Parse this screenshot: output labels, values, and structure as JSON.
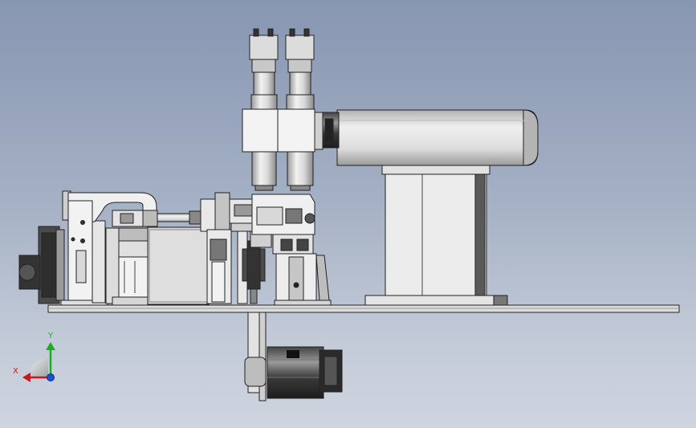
{
  "triad": {
    "x_label": "X",
    "y_label": "Y"
  },
  "motor_label": "",
  "colors": {
    "background_top": "#8796b2",
    "background_bottom": "#cfd5df",
    "part_fill": "#e6e6e6",
    "part_edge": "#222222",
    "axis_x": "#d0141a",
    "axis_y": "#1bb01b",
    "axis_z": "#1a4fd0"
  }
}
